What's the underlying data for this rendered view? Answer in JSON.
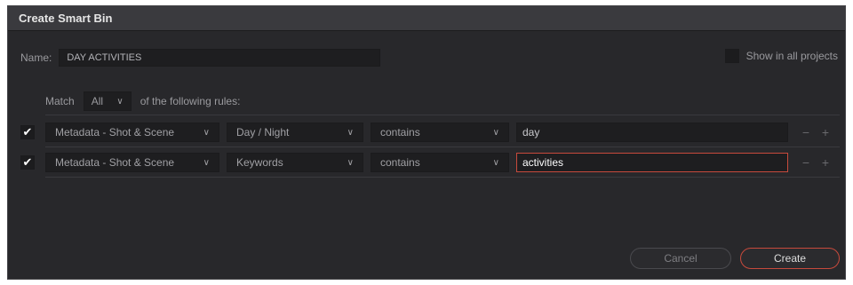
{
  "dialog": {
    "title": "Create Smart Bin"
  },
  "name_row": {
    "label": "Name:",
    "value": "DAY ACTIVITIES"
  },
  "show_all": {
    "label": "Show in all projects",
    "checked": false
  },
  "match": {
    "prefix": "Match",
    "value": "All",
    "suffix": "of the following rules:"
  },
  "rules": [
    {
      "checked": true,
      "category": "Metadata - Shot & Scene",
      "field": "Day / Night",
      "operator": "contains",
      "value": "day"
    },
    {
      "checked": true,
      "category": "Metadata - Shot & Scene",
      "field": "Keywords",
      "operator": "contains",
      "value": "activities"
    }
  ],
  "glyphs": {
    "check": "✔",
    "chevron": "∨",
    "minus": "−",
    "plus": "+"
  },
  "buttons": {
    "cancel": "Cancel",
    "create": "Create"
  },
  "colors": {
    "accent": "#c74a3c",
    "background": "#28282b",
    "titlebar": "#3a3a3e"
  }
}
